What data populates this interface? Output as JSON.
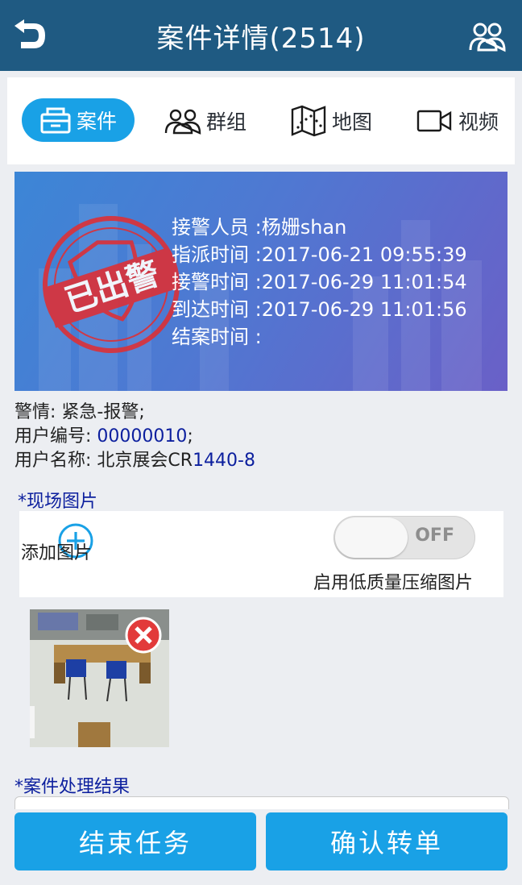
{
  "header": {
    "title": "案件详情(2514)"
  },
  "tabs": [
    {
      "label": "案件",
      "icon": "case-icon",
      "active": true
    },
    {
      "label": "群组",
      "icon": "group-icon",
      "active": false
    },
    {
      "label": "地图",
      "icon": "map-icon",
      "active": false
    },
    {
      "label": "视频",
      "icon": "video-icon",
      "active": false
    }
  ],
  "hero": {
    "stamp_text": "已出警",
    "rows": [
      "接警人员 :杨姗shan",
      "指派时间 :2017-06-21 09:55:39",
      "接警时间 :2017-06-29 11:01:54",
      "到达时间 :2017-06-29 11:01:56",
      "结案时间 :"
    ]
  },
  "details": {
    "alert_label": "警情: ",
    "alert_value": "紧急-报警;",
    "user_no_label": "用户编号: ",
    "user_no_value": "00000010",
    "user_no_suffix": ";",
    "user_name_label": "用户名称: 北京展会CR",
    "user_name_value": "1440-8"
  },
  "photos": {
    "section_label": "*现场图片",
    "add_label": "添加图片",
    "toggle_state": "OFF",
    "toggle_label": "启用低质量压缩图片"
  },
  "result": {
    "section_label": "*案件处理结果",
    "value": ""
  },
  "actions": {
    "end_task": "结束任务",
    "confirm_transfer": "确认转单"
  },
  "colors": {
    "header_bg": "#1f5a82",
    "accent": "#19a1e6",
    "value_text": "#0c1f9e",
    "remove_red": "#e23a3a"
  }
}
